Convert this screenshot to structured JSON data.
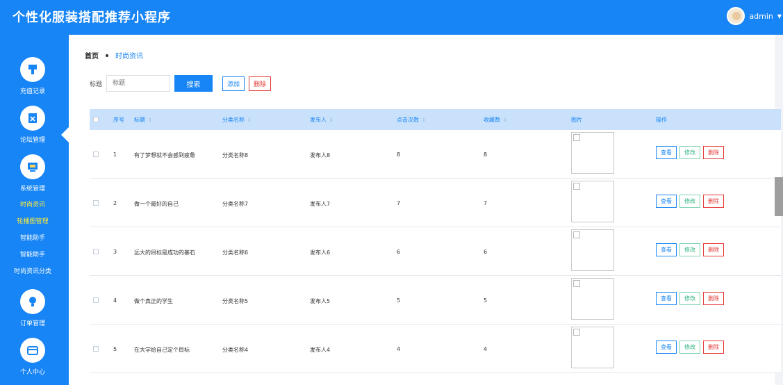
{
  "header": {
    "title": "个性化服装搭配推荐小程序",
    "username": "admin"
  },
  "sidebar": {
    "menus": [
      {
        "label": "充值记录",
        "icon": "brush-icon"
      },
      {
        "label": "论坛管理",
        "icon": "clipboard-icon"
      },
      {
        "label": "系统管理",
        "icon": "monitor-icon"
      },
      {
        "label": "订单管理",
        "icon": "lightbulb-icon"
      },
      {
        "label": "个人中心",
        "icon": "wallet-icon"
      }
    ],
    "submenus": [
      {
        "label": "时尚资讯"
      },
      {
        "label": "轮播图管理"
      },
      {
        "label": "智能助手"
      },
      {
        "label": "智能助手"
      },
      {
        "label": "时尚资讯分类"
      }
    ]
  },
  "breadcrumb": {
    "home": "首页",
    "current": "时尚资讯"
  },
  "search": {
    "label": "标题",
    "placeholder": "标题",
    "search_button": "搜索",
    "add_button": "添加",
    "delete_button": "删除"
  },
  "table": {
    "headers": [
      "序号",
      "标题",
      "分类名称",
      "发布人",
      "点击次数",
      "收藏数",
      "图片",
      "操作"
    ],
    "rows": [
      {
        "index": "1",
        "title": "有了梦想就不会感到疲惫",
        "category": "分类名称8",
        "publisher": "发布人8",
        "clicks": "8",
        "favorites": "8"
      },
      {
        "index": "2",
        "title": "做一个最好的自己",
        "category": "分类名称7",
        "publisher": "发布人7",
        "clicks": "7",
        "favorites": "7"
      },
      {
        "index": "3",
        "title": "远大的目标是成功的基石",
        "category": "分类名称6",
        "publisher": "发布人6",
        "clicks": "6",
        "favorites": "6"
      },
      {
        "index": "4",
        "title": "做个真正的学生",
        "category": "分类名称5",
        "publisher": "发布人5",
        "clicks": "5",
        "favorites": "5"
      },
      {
        "index": "5",
        "title": "在大学给自己定个目标",
        "category": "分类名称4",
        "publisher": "发布人4",
        "clicks": "4",
        "favorites": "4"
      }
    ],
    "actions": {
      "view": "查看",
      "edit": "修改",
      "delete": "删除"
    }
  },
  "colors": {
    "primary": "#1785f5",
    "header_row": "#c9e1fb",
    "danger": "#e53935",
    "success": "#2eb37f",
    "active_menu": "#ffeb3b"
  }
}
